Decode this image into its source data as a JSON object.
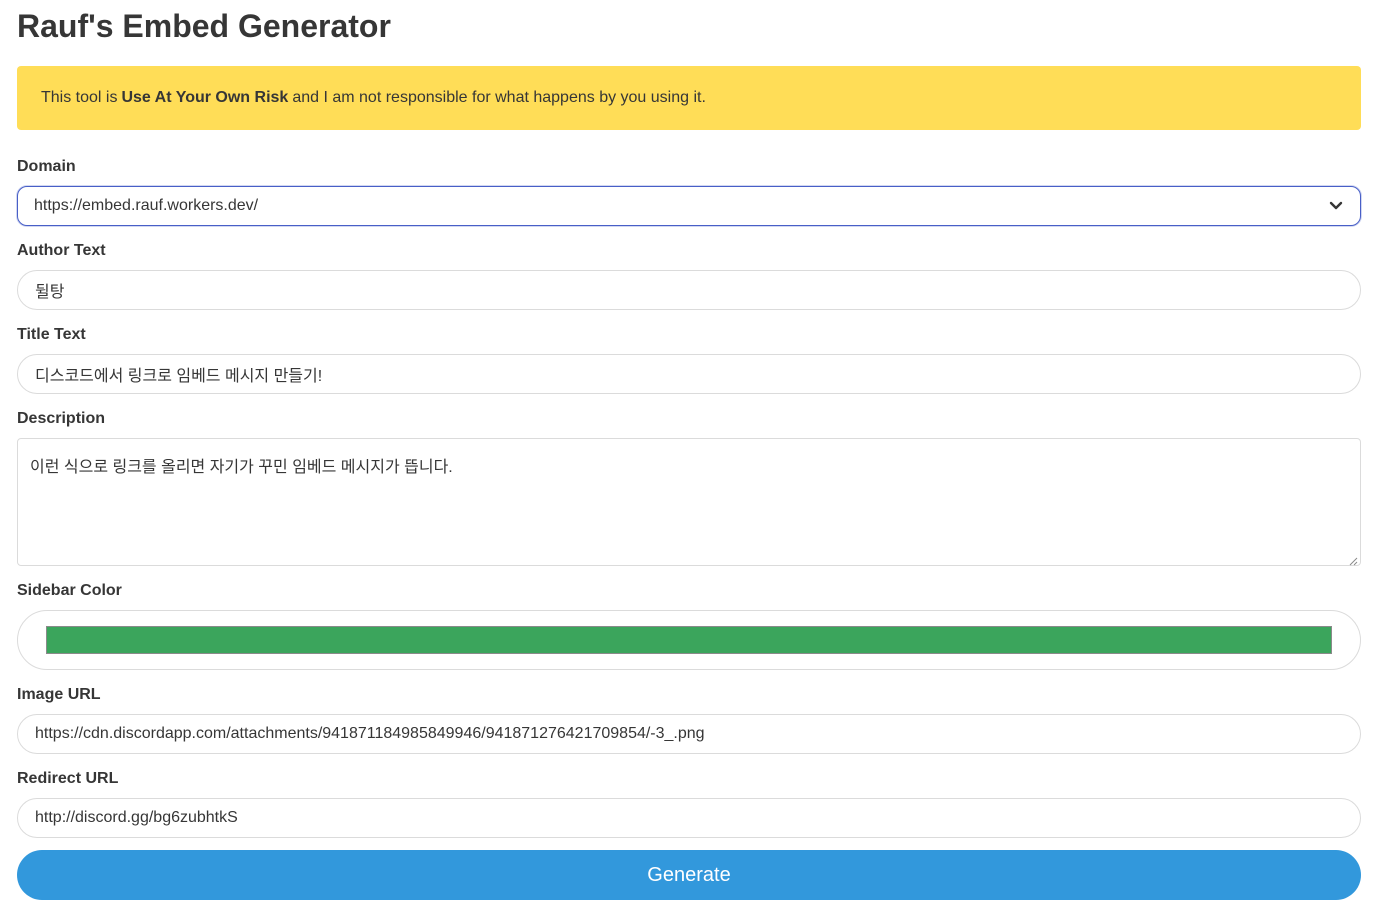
{
  "title": "Rauf's Embed Generator",
  "notice": {
    "prefix": "This tool is",
    "emphasis": "Use At Your Own Risk",
    "suffix": "and I am not responsible for what happens by you using it.",
    "background": "#ffdd57"
  },
  "domain": {
    "label": "Domain",
    "selected": "https://embed.rauf.workers.dev/",
    "icon": "chevron-down-icon"
  },
  "author": {
    "label": "Author Text",
    "value": "뒬탕"
  },
  "title_field": {
    "label": "Title Text",
    "value": "디스코드에서 링크로 임베드 메시지 만들기!"
  },
  "description": {
    "label": "Description",
    "value": "이런 식으로 링크를 올리면 자기가 꾸민 임베드 메시지가 뜹니다."
  },
  "sidebar_color": {
    "label": "Sidebar Color",
    "value": "#3ba55c"
  },
  "image_url": {
    "label": "Image URL",
    "value": "https://cdn.discordapp.com/attachments/941871184985849946/941871276421709854/-3_.png"
  },
  "redirect_url": {
    "label": "Redirect URL",
    "value": "http://discord.gg/bg6zubhtkS"
  },
  "generate_button": {
    "label": "Generate",
    "color": "#3298dc"
  }
}
